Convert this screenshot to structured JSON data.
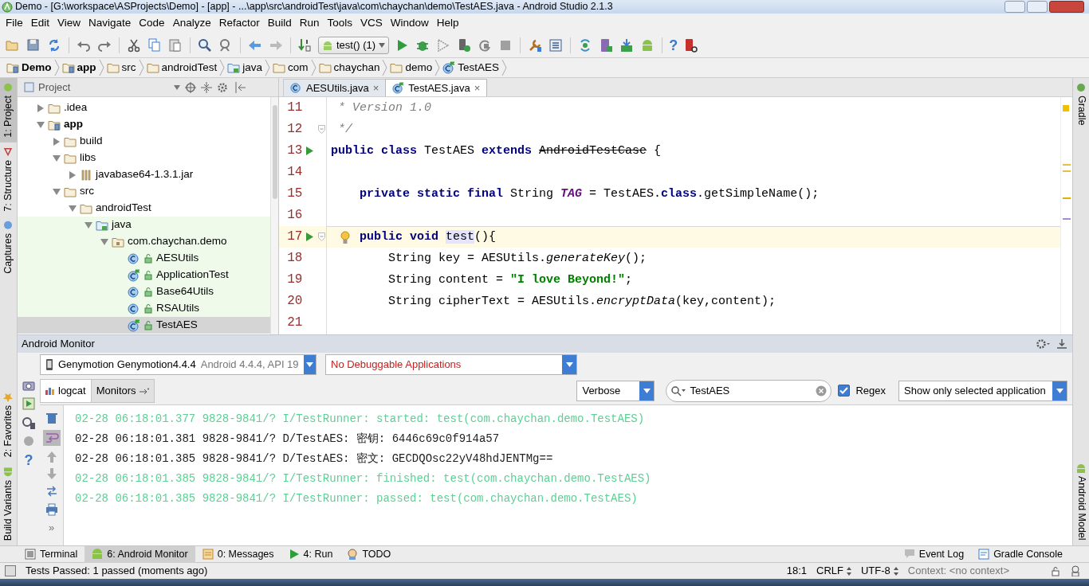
{
  "window": {
    "title": "Demo - [G:\\workspace\\ASProjects\\Demo] - [app] - ...\\app\\src\\androidTest\\java\\com\\chaychan\\demo\\TestAES.java - Android Studio 2.1.3"
  },
  "menu": [
    "File",
    "Edit",
    "View",
    "Navigate",
    "Code",
    "Analyze",
    "Refactor",
    "Build",
    "Run",
    "Tools",
    "VCS",
    "Window",
    "Help"
  ],
  "toolbar": {
    "run_config": "test() (1)",
    "help_glyph": "?"
  },
  "breadcrumbs": [
    {
      "label": "Demo",
      "kind": "module",
      "bold": true
    },
    {
      "label": "app",
      "kind": "module",
      "bold": true
    },
    {
      "label": "src",
      "kind": "folder",
      "bold": false
    },
    {
      "label": "androidTest",
      "kind": "folder",
      "bold": false
    },
    {
      "label": "java",
      "kind": "source-folder",
      "bold": false
    },
    {
      "label": "com",
      "kind": "folder",
      "bold": false
    },
    {
      "label": "chaychan",
      "kind": "folder",
      "bold": false
    },
    {
      "label": "demo",
      "kind": "folder",
      "bold": false
    },
    {
      "label": "TestAES",
      "kind": "test-class",
      "bold": false
    }
  ],
  "left_strip": {
    "top": [
      {
        "label": "1: Project",
        "selected": true
      },
      {
        "label": "7: Structure",
        "selected": false
      },
      {
        "label": "Captures",
        "selected": false
      }
    ],
    "bottom": [
      {
        "label": "2: Favorites",
        "selected": false
      },
      {
        "label": "Build Variants",
        "selected": false
      }
    ]
  },
  "right_strip": [
    {
      "label": "Gradle"
    },
    {
      "label": "Android Model"
    }
  ],
  "project_panel": {
    "title": "Project",
    "tree": [
      {
        "label": ".idea",
        "kind": "folder",
        "expanded": false,
        "selected": false,
        "test_scope": false
      },
      {
        "label": "app",
        "kind": "module",
        "expanded": true,
        "selected": false,
        "test_scope": false,
        "children": [
          {
            "label": "build",
            "kind": "folder",
            "expanded": false,
            "selected": false,
            "test_scope": false
          },
          {
            "label": "libs",
            "kind": "folder",
            "expanded": true,
            "selected": false,
            "test_scope": false,
            "children": [
              {
                "label": "javabase64-1.3.1.jar",
                "kind": "jar",
                "expanded": false,
                "selected": false,
                "test_scope": false
              }
            ]
          },
          {
            "label": "src",
            "kind": "folder",
            "expanded": true,
            "selected": false,
            "test_scope": false,
            "children": [
              {
                "label": "androidTest",
                "kind": "folder",
                "expanded": true,
                "selected": false,
                "test_scope": false,
                "children": [
                  {
                    "label": "java",
                    "kind": "source-folder",
                    "expanded": true,
                    "selected": false,
                    "test_scope": true,
                    "children": [
                      {
                        "label": "com.chaychan.demo",
                        "kind": "package",
                        "expanded": true,
                        "selected": false,
                        "test_scope": true,
                        "children": [
                          {
                            "label": "AESUtils",
                            "kind": "class",
                            "selected": false,
                            "test_scope": true
                          },
                          {
                            "label": "ApplicationTest",
                            "kind": "test-class",
                            "selected": false,
                            "test_scope": true
                          },
                          {
                            "label": "Base64Utils",
                            "kind": "class",
                            "selected": false,
                            "test_scope": true
                          },
                          {
                            "label": "RSAUtils",
                            "kind": "class",
                            "selected": false,
                            "test_scope": true
                          },
                          {
                            "label": "TestAES",
                            "kind": "test-class",
                            "selected": true,
                            "test_scope": true
                          }
                        ]
                      }
                    ]
                  }
                ]
              }
            ]
          }
        ]
      }
    ]
  },
  "editor": {
    "tabs": [
      {
        "label": "AESUtils.java",
        "kind": "class",
        "selected": false,
        "close": "×"
      },
      {
        "label": "TestAES.java",
        "kind": "test-class",
        "selected": true,
        "close": "×"
      }
    ],
    "lines": [
      {
        "number": "11",
        "run": false,
        "fold": false,
        "bulb": false,
        "current": false,
        "tokens": [
          {
            "text": " * Version 1.0",
            "kind": "comment"
          }
        ]
      },
      {
        "number": "12",
        "run": false,
        "fold": true,
        "bulb": false,
        "current": false,
        "tokens": [
          {
            "text": " */",
            "kind": "comment"
          }
        ]
      },
      {
        "number": "13",
        "run": true,
        "fold": false,
        "bulb": false,
        "current": false,
        "tokens": [
          {
            "text": "public class",
            "kind": "keyword"
          },
          {
            "text": " TestAES ",
            "kind": "plain"
          },
          {
            "text": "extends ",
            "kind": "keyword"
          },
          {
            "text": "AndroidTestCase",
            "kind": "deprecated"
          },
          {
            "text": " {",
            "kind": "plain"
          }
        ]
      },
      {
        "number": "14",
        "run": false,
        "fold": false,
        "bulb": false,
        "current": false
      },
      {
        "number": "15",
        "run": false,
        "fold": false,
        "bulb": false,
        "current": false,
        "tokens": [
          {
            "text": "    private static final",
            "kind": "keyword"
          },
          {
            "text": " String ",
            "kind": "plain"
          },
          {
            "text": "TAG",
            "kind": "static"
          },
          {
            "text": " = TestAES.",
            "kind": "plain"
          },
          {
            "text": "class",
            "kind": "keyword"
          },
          {
            "text": ".getSimpleName();",
            "kind": "plain"
          }
        ]
      },
      {
        "number": "16",
        "run": false,
        "fold": false,
        "bulb": false,
        "current": false
      },
      {
        "number": "17",
        "run": true,
        "fold": true,
        "bulb": true,
        "current": true,
        "tokens": [
          {
            "text": "    public void ",
            "kind": "keyword"
          },
          {
            "text": "test",
            "kind": "highlight"
          },
          {
            "text": "(){",
            "kind": "plain"
          }
        ]
      },
      {
        "number": "18",
        "run": false,
        "fold": false,
        "bulb": false,
        "current": false,
        "tokens": [
          {
            "text": "        String key = AESUtils.",
            "kind": "plain"
          },
          {
            "text": "generateKey",
            "kind": "italic"
          },
          {
            "text": "();",
            "kind": "plain"
          }
        ]
      },
      {
        "number": "19",
        "run": false,
        "fold": false,
        "bulb": false,
        "current": false,
        "tokens": [
          {
            "text": "        String content = ",
            "kind": "plain"
          },
          {
            "text": "\"I love Beyond!\"",
            "kind": "string"
          },
          {
            "text": ";",
            "kind": "plain"
          }
        ]
      },
      {
        "number": "20",
        "run": false,
        "fold": false,
        "bulb": false,
        "current": false,
        "tokens": [
          {
            "text": "        String cipherText = AESUtils.",
            "kind": "plain"
          },
          {
            "text": "encryptData",
            "kind": "italic"
          },
          {
            "text": "(key,content);",
            "kind": "plain"
          }
        ]
      },
      {
        "number": "21",
        "run": false,
        "fold": false,
        "bulb": false,
        "current": false
      }
    ]
  },
  "monitor": {
    "title": "Android Monitor",
    "device": {
      "name": "Genymotion Genymotion4.4.4",
      "detail": "Android 4.4.4, API 19"
    },
    "app_filter": "No Debuggable Applications",
    "tabs": [
      {
        "label": "logcat",
        "selected": true
      },
      {
        "label": "Monitors",
        "selected": false
      }
    ],
    "log_level": "Verbose",
    "search": {
      "value": "TestAES"
    },
    "regex": {
      "label": "Regex",
      "checked": true
    },
    "filter": "Show only selected application",
    "side_glyphs": {
      "help": "?",
      "more": "»"
    },
    "lines": [
      {
        "text": "02-28 06:18:01.377 9828-9841/? I/TestRunner: started: test(com.chaychan.demo.TestAES)",
        "kind": "info"
      },
      {
        "text": "02-28 06:18:01.381 9828-9841/? D/TestAES: 密钥: 6446c69c0f914a57",
        "kind": "debug"
      },
      {
        "text": "02-28 06:18:01.385 9828-9841/? D/TestAES: 密文: GECDQOsc22yV48hdJENTMg==",
        "kind": "debug"
      },
      {
        "text": "02-28 06:18:01.385 9828-9841/? I/TestRunner: finished: test(com.chaychan.demo.TestAES)",
        "kind": "info"
      },
      {
        "text": "02-28 06:18:01.385 9828-9841/? I/TestRunner: passed: test(com.chaychan.demo.TestAES)",
        "kind": "info"
      }
    ]
  },
  "bottom_tabs": {
    "left": [
      {
        "label": "Terminal",
        "kind": "terminal",
        "selected": false
      },
      {
        "label": "6: Android Monitor",
        "kind": "android",
        "selected": true
      },
      {
        "label": "0: Messages",
        "kind": "messages",
        "selected": false
      },
      {
        "label": "4: Run",
        "kind": "run",
        "selected": false
      },
      {
        "label": "TODO",
        "kind": "todo",
        "selected": false
      }
    ],
    "right": [
      {
        "label": "Event Log",
        "kind": "event-log",
        "selected": false
      },
      {
        "label": "Gradle Console",
        "kind": "console",
        "selected": false
      }
    ]
  },
  "status_bar": {
    "message": "Tests Passed: 1 passed (moments ago)",
    "position": "18:1",
    "line_separator": "CRLF",
    "encoding": "UTF-8",
    "context": "Context: <no context>"
  }
}
